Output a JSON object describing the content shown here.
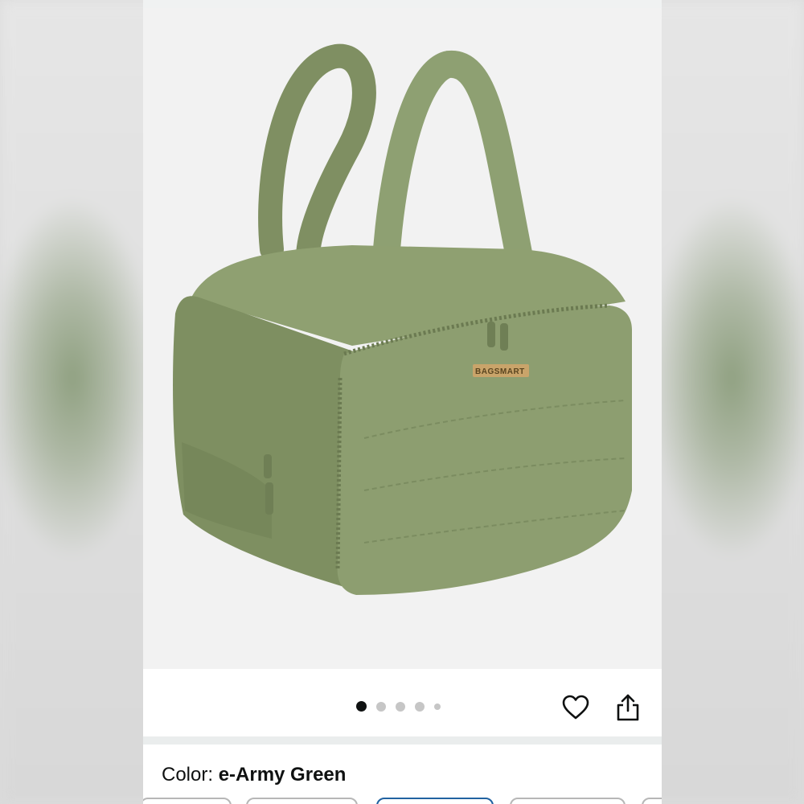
{
  "product": {
    "brand_tag": "BAGSMART",
    "image_alt": "Army green quilted toiletry bag with two handles"
  },
  "carousel": {
    "total_dots": 5,
    "active_index": 0
  },
  "actions": {
    "wishlist_icon": "heart-icon",
    "share_icon": "share-icon"
  },
  "variation": {
    "label": "Color: ",
    "value": "e-Army Green"
  },
  "colors": {
    "bag": "#8a9a6c",
    "accent": "#2162a1",
    "text": "#0f1111"
  }
}
